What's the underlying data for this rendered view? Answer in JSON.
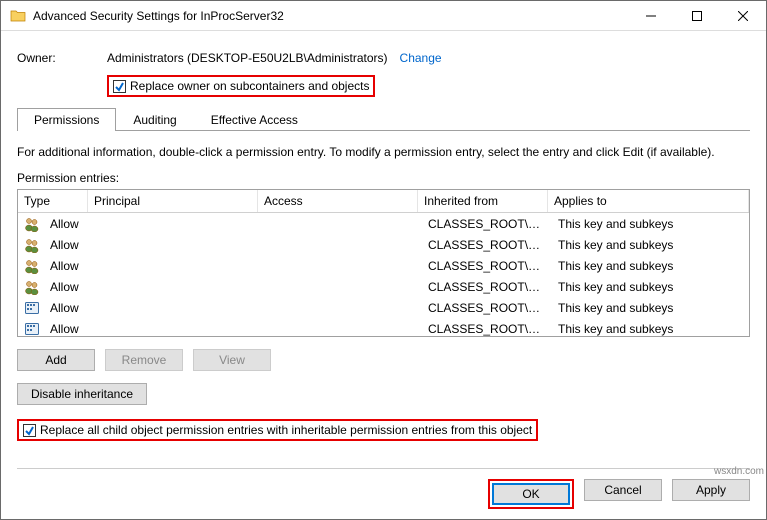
{
  "titlebar": {
    "title": "Advanced Security Settings for InProcServer32"
  },
  "owner": {
    "label": "Owner:",
    "value": "Administrators (DESKTOP-E50U2LB\\Administrators)",
    "change": "Change",
    "replace_cb": "Replace owner on subcontainers and objects"
  },
  "tabs": {
    "permissions": "Permissions",
    "auditing": "Auditing",
    "effective": "Effective Access"
  },
  "info": "For additional information, double-click a permission entry. To modify a permission entry, select the entry and click Edit (if available).",
  "entries_label": "Permission entries:",
  "columns": {
    "type": "Type",
    "principal": "Principal",
    "access": "Access",
    "inherited": "Inherited from",
    "applies": "Applies to"
  },
  "rows": [
    {
      "icon": "users",
      "type": "Allow",
      "principal": "",
      "access": "",
      "inherited": "CLASSES_ROOT\\CLSID...",
      "applies": "This key and subkeys"
    },
    {
      "icon": "users",
      "type": "Allow",
      "principal": "",
      "access": "",
      "inherited": "CLASSES_ROOT\\CLSID...",
      "applies": "This key and subkeys"
    },
    {
      "icon": "users",
      "type": "Allow",
      "principal": "",
      "access": "",
      "inherited": "CLASSES_ROOT\\CLSID...",
      "applies": "This key and subkeys"
    },
    {
      "icon": "users",
      "type": "Allow",
      "principal": "",
      "access": "",
      "inherited": "CLASSES_ROOT\\CLSID...",
      "applies": "This key and subkeys"
    },
    {
      "icon": "key",
      "type": "Allow",
      "principal": "",
      "access": "",
      "inherited": "CLASSES_ROOT\\CLSID...",
      "applies": "This key and subkeys"
    },
    {
      "icon": "key",
      "type": "Allow",
      "principal": "",
      "access": "",
      "inherited": "CLASSES_ROOT\\CLSID...",
      "applies": "This key and subkeys"
    }
  ],
  "buttons": {
    "add": "Add",
    "remove": "Remove",
    "view": "View",
    "disable_inh": "Disable inheritance"
  },
  "replace_child": "Replace all child object permission entries with inheritable permission entries from this object",
  "footer": {
    "ok": "OK",
    "cancel": "Cancel",
    "apply": "Apply"
  },
  "watermark": "wsxdn.com"
}
